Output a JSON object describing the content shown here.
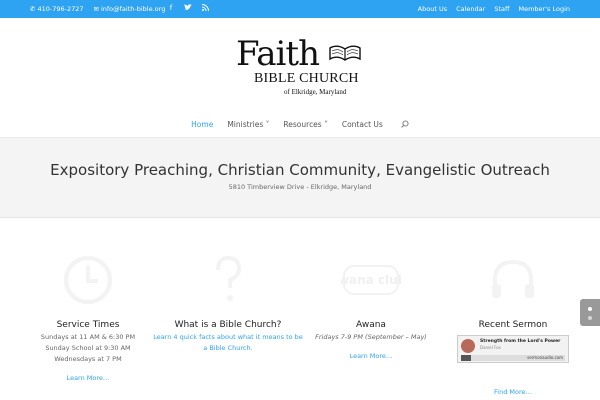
{
  "topbar": {
    "phone": "410-796-2727",
    "email": "info@faith-bible.org",
    "social": [
      "facebook-icon",
      "twitter-icon",
      "rss-icon"
    ],
    "links": [
      "About Us",
      "Calendar",
      "Staff",
      "Member's Login"
    ]
  },
  "logo": {
    "line1": "Faith",
    "line2": "BIBLE CHURCH",
    "line3": "of Elkridge, Maryland"
  },
  "nav": {
    "home": "Home",
    "ministries": "Ministries ˅",
    "resources": "Resources ˅",
    "contact": "Contact Us"
  },
  "hero": {
    "title": "Expository Preaching, Christian Community, Evangelistic Outreach",
    "address": "5810 Timberview Drive - Elkridge, Maryland"
  },
  "features": {
    "service": {
      "title": "Service Times",
      "line1": "Sundays at 11 AM & 6:30 PM",
      "line2": "Sunday School at 9:30 AM",
      "line3": "Wednesdays at 7 PM",
      "more": "Learn More…"
    },
    "bible": {
      "title": "What is a Bible Church?",
      "text": "Learn 4 quick facts about what it means to be a Bible Church."
    },
    "awana": {
      "title": "Awana",
      "text": "Fridays 7-9 PM (September – May)",
      "more": "Learn More…",
      "logo_text": "Awana clubs"
    },
    "sermon": {
      "title": "Recent Sermon",
      "player_title": "Strength from the Lord's Power",
      "player_sub": "Daniel Fox",
      "player_brand": "sermonaudio.com",
      "more": "Find More…"
    }
  },
  "colors": {
    "accent": "#2ea3f2",
    "hero_bg": "#f4f4f4"
  }
}
